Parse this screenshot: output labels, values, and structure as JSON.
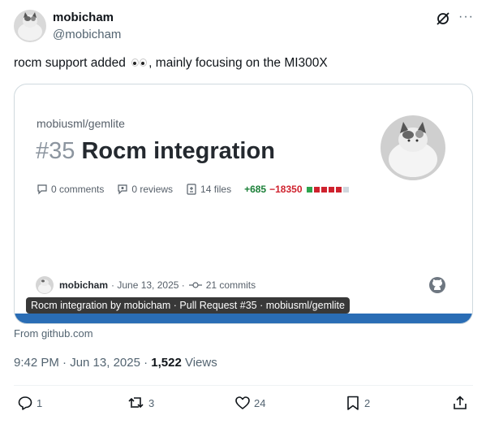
{
  "author": {
    "display_name": "mobicham",
    "handle": "@mobicham"
  },
  "header_icons": [
    "grok-icon",
    "more-icon"
  ],
  "tweet": {
    "text_before": "rocm support added",
    "emoji": "eyes",
    "text_after": ", mainly focusing on the MI300X"
  },
  "card": {
    "repo": "mobiusml/gemlite",
    "pr_number": "#35",
    "pr_title": "Rocm integration",
    "comments": "0 comments",
    "reviews": "0 reviews",
    "files": "14 files",
    "additions": "+685",
    "deletions": "−18350",
    "diff_blocks": [
      "#2da44e",
      "#cf222e",
      "#cf222e",
      "#cf222e",
      "#cf222e",
      "#d0d7de"
    ],
    "pr_author": "mobicham",
    "date": "· June 13, 2025 ·",
    "commits": "21 commits",
    "caption": "Rocm integration by mobicham · Pull Request #35 · mobiusml/gemlite",
    "accent_color": "#2a6db5"
  },
  "source": "From github.com",
  "meta": {
    "time": "9:42 PM · Jun 13, 2025 · ",
    "views_count": "1,522",
    "views_label": " Views"
  },
  "actions": {
    "replies": "1",
    "reposts": "3",
    "likes": "24",
    "bookmarks": "2"
  }
}
